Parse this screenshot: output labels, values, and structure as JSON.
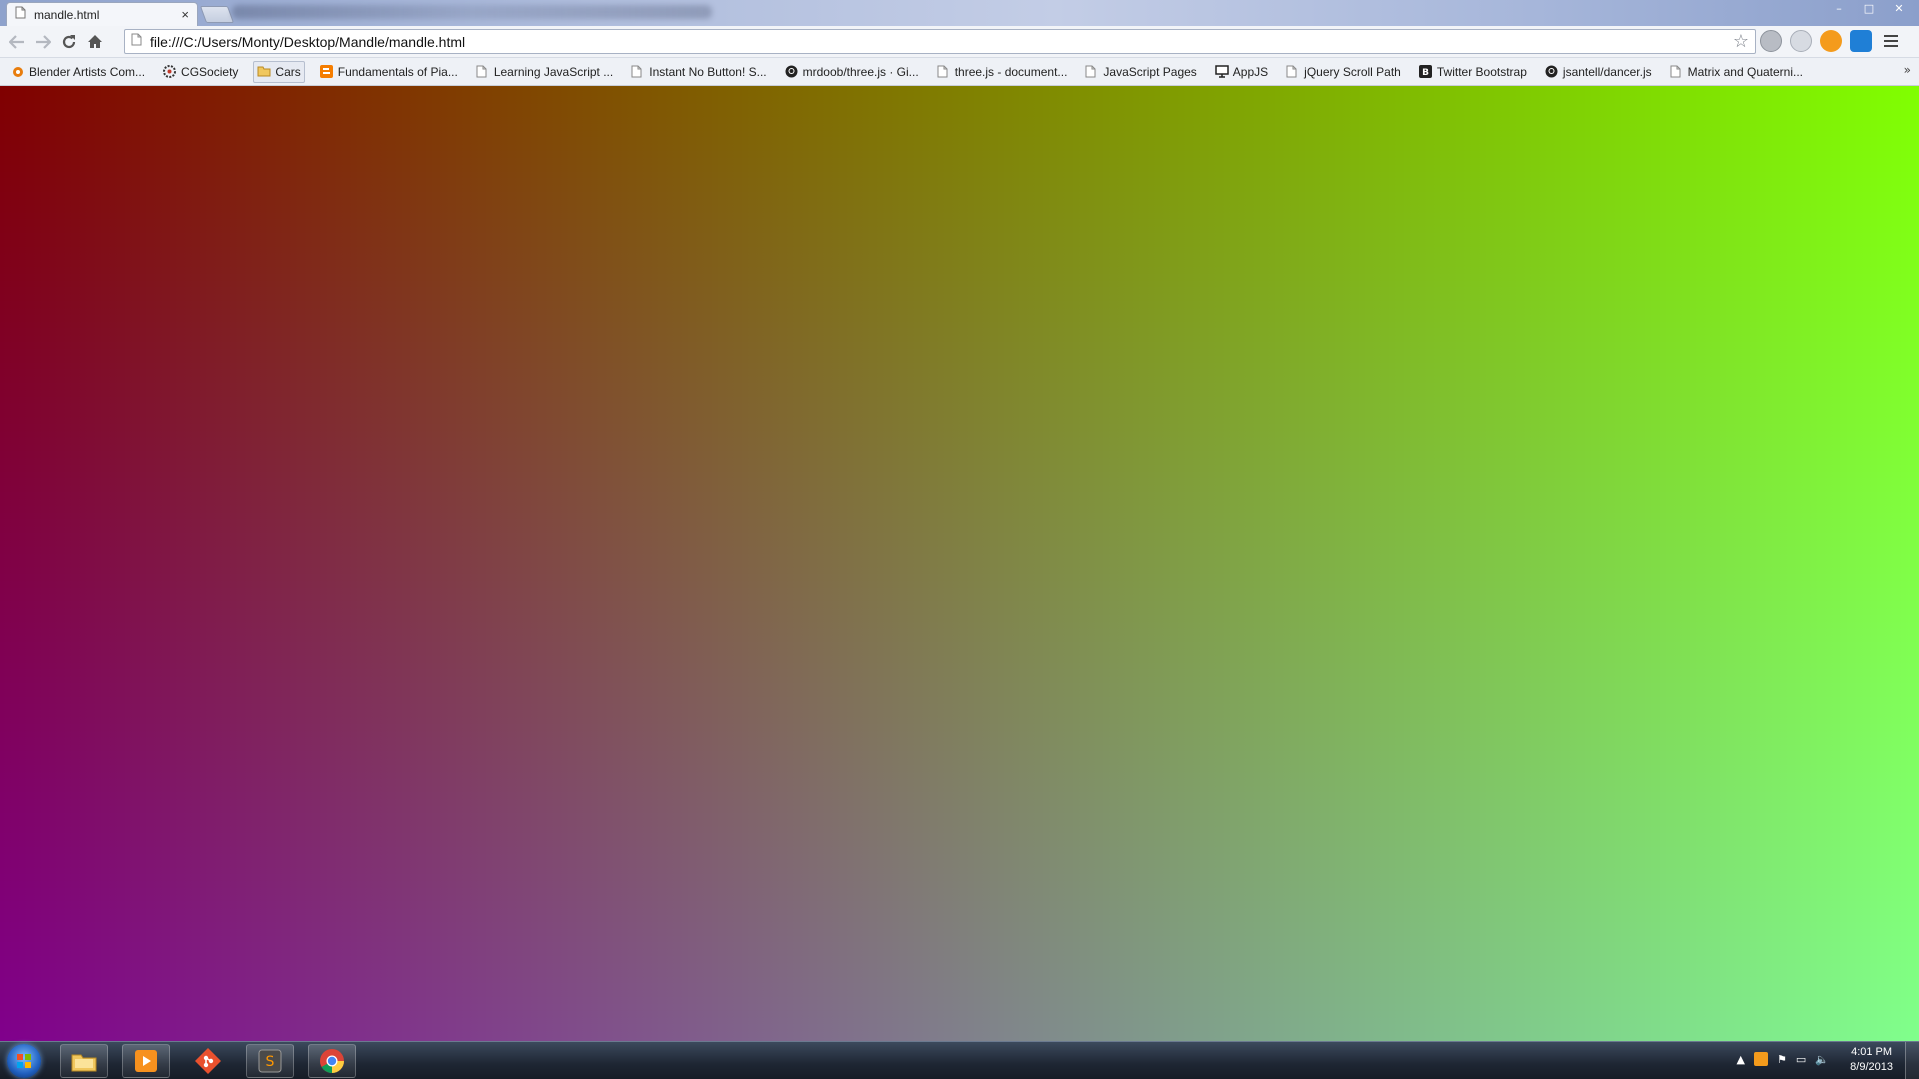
{
  "browser": {
    "tab": {
      "title": "mandle.html",
      "close": "×"
    },
    "window_controls": {
      "minimize": "–",
      "maximize": "□",
      "close": "✕"
    },
    "url": "file:///C:/Users/Monty/Desktop/Mandle/mandle.html",
    "bookmarks": [
      {
        "label": "Blender Artists Com...",
        "icon": "blender-icon"
      },
      {
        "label": "CGSociety",
        "icon": "cgsociety-icon"
      },
      {
        "label": "Cars",
        "icon": "folder-icon"
      },
      {
        "label": "Fundamentals of Pia...",
        "icon": "blogger-icon"
      },
      {
        "label": "Learning JavaScript ...",
        "icon": "page-icon"
      },
      {
        "label": "Instant No Button! S...",
        "icon": "page-icon"
      },
      {
        "label": "mrdoob/three.js · Gi...",
        "icon": "github-icon"
      },
      {
        "label": "three.js - document...",
        "icon": "page-icon"
      },
      {
        "label": "JavaScript Pages",
        "icon": "page-icon"
      },
      {
        "label": "AppJS",
        "icon": "monitor-icon"
      },
      {
        "label": "jQuery Scroll Path",
        "icon": "page-icon"
      },
      {
        "label": "Twitter Bootstrap",
        "icon": "bootstrap-icon"
      },
      {
        "label": "jsantell/dancer.js",
        "icon": "github-icon"
      },
      {
        "label": "Matrix and Quaterni...",
        "icon": "page-icon"
      }
    ],
    "bookmarks_overflow": "»"
  },
  "taskbar": {
    "clock_time": "4:01 PM",
    "clock_date": "8/9/2013",
    "tray_expand": "▲",
    "pinned": [
      "explorer-icon",
      "media-player-icon",
      "git-icon",
      "sublime-text-icon",
      "chrome-icon"
    ]
  },
  "colors": {
    "gradient_top_left": "#800000",
    "gradient_top_right": "#80ff00",
    "gradient_bottom_left": "#8000ff",
    "gradient_bottom_right": "#80ff80"
  }
}
